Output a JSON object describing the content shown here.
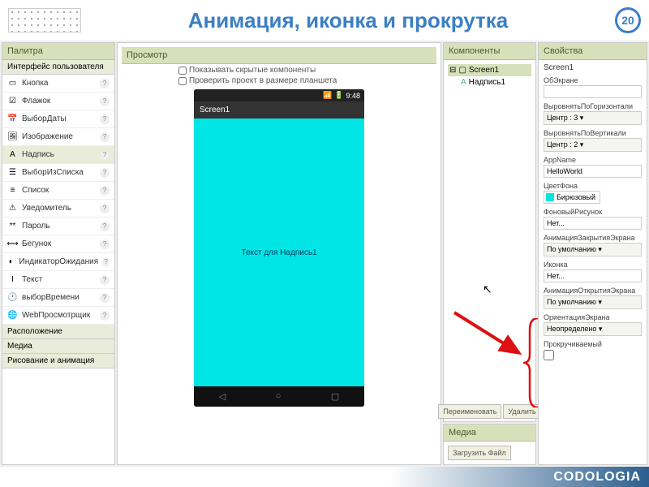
{
  "header": {
    "title": "Анимация, иконка и прокрутка",
    "page_number": "20"
  },
  "palette": {
    "title": "Палитра",
    "section_ui": "Интерфейс пользователя",
    "items": [
      {
        "label": "Кнопка",
        "icon": "▭"
      },
      {
        "label": "Флажок",
        "icon": "☑"
      },
      {
        "label": "ВыборДаты",
        "icon": "📅"
      },
      {
        "label": "Изображение",
        "icon": "🖼"
      },
      {
        "label": "Надпись",
        "icon": "A",
        "selected": true
      },
      {
        "label": "ВыборИзСписка",
        "icon": "☰"
      },
      {
        "label": "Список",
        "icon": "≡"
      },
      {
        "label": "Уведомитель",
        "icon": "⚠"
      },
      {
        "label": "Пароль",
        "icon": "**"
      },
      {
        "label": "Бегунок",
        "icon": "⟷"
      },
      {
        "label": "ИндикаторОжидания",
        "icon": "◐"
      },
      {
        "label": "Текст",
        "icon": "I"
      },
      {
        "label": "выборВремени",
        "icon": "🕐"
      },
      {
        "label": "WebПросмотрщик",
        "icon": "🌐"
      }
    ],
    "section_layout": "Расположение",
    "section_media": "Медиа",
    "section_drawing": "Рисование и анимация"
  },
  "viewer": {
    "title": "Просмотр",
    "show_hidden": "Показывать скрытые компоненты",
    "check_tablet": "Проверить проект в размере планшета",
    "status_time": "9:48",
    "app_title": "Screen1",
    "label_text": "Текст для Надпись1"
  },
  "components": {
    "title": "Компоненты",
    "screen": "Screen1",
    "label": "Надпись1",
    "rename": "Переименовать",
    "delete": "Удалить"
  },
  "media": {
    "title": "Медиа",
    "upload": "Загрузить Файл"
  },
  "props": {
    "title": "Свойства",
    "screen_name": "Screen1",
    "about": {
      "label": "ОбЭкране",
      "value": ""
    },
    "halign": {
      "label": "ВыровнятьПоГоризонтали",
      "value": "Центр : 3 ▾"
    },
    "valign": {
      "label": "ВыровнятьПоВертикали",
      "value": "Центр : 2 ▾"
    },
    "appname": {
      "label": "AppName",
      "value": "HelloWorld"
    },
    "bgcolor": {
      "label": "ЦветФона",
      "value": "Бирюзовый"
    },
    "bgimage": {
      "label": "ФоновыйРисунок",
      "value": "Нет..."
    },
    "close_anim": {
      "label": "АнимацияЗакрытияЭкрана",
      "value": "По умолчанию ▾"
    },
    "icon": {
      "label": "Иконка",
      "value": "Нет..."
    },
    "open_anim": {
      "label": "АнимацияОткрытияЭкрана",
      "value": "По умолчанию ▾"
    },
    "orientation": {
      "label": "ОриентацияЭкрана",
      "value": "Неопределено ▾"
    },
    "scrollable": {
      "label": "Прокручиваемый"
    }
  },
  "footer": {
    "logo": "CODOLOGIA"
  }
}
